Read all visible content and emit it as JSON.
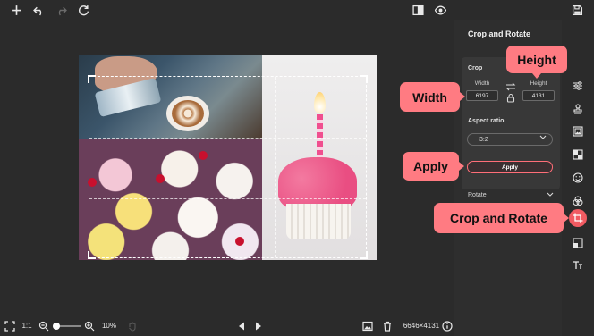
{
  "toolbar": {
    "add_icon": "plus-icon",
    "undo_icon": "undo-icon",
    "redo_icon": "redo-icon",
    "reset_icon": "reset-icon",
    "compare_icon": "compare-icon",
    "preview_icon": "eye-icon",
    "save_icon": "save-icon"
  },
  "panel": {
    "title": "Crop and Rotate",
    "crop_heading": "Crop",
    "width_label": "Width",
    "height_label": "Height",
    "width_value": "6197",
    "height_value": "4131",
    "aspect_label": "Aspect ratio",
    "aspect_value": "3:2",
    "apply_label": "Apply",
    "rotate_label": "Rotate"
  },
  "bottom": {
    "fit_icon": "fit-screen-icon",
    "ratio_label": "1:1",
    "zoom_value": "10%",
    "image_size": "6646×4131"
  },
  "callouts": {
    "width": "Width",
    "height": "Height",
    "apply": "Apply",
    "crop_rotate": "Crop and Rotate"
  },
  "tools": [
    "adjust-icon",
    "stamp-icon",
    "image-frame-icon",
    "texture-icon",
    "emoji-icon",
    "color-filter-icon",
    "crop-icon",
    "resize-icon",
    "text-icon"
  ],
  "colors": {
    "accent": "#f15b62",
    "callout": "#ff7b82",
    "panel": "#2e2e2e",
    "background": "#2b2b2b"
  }
}
